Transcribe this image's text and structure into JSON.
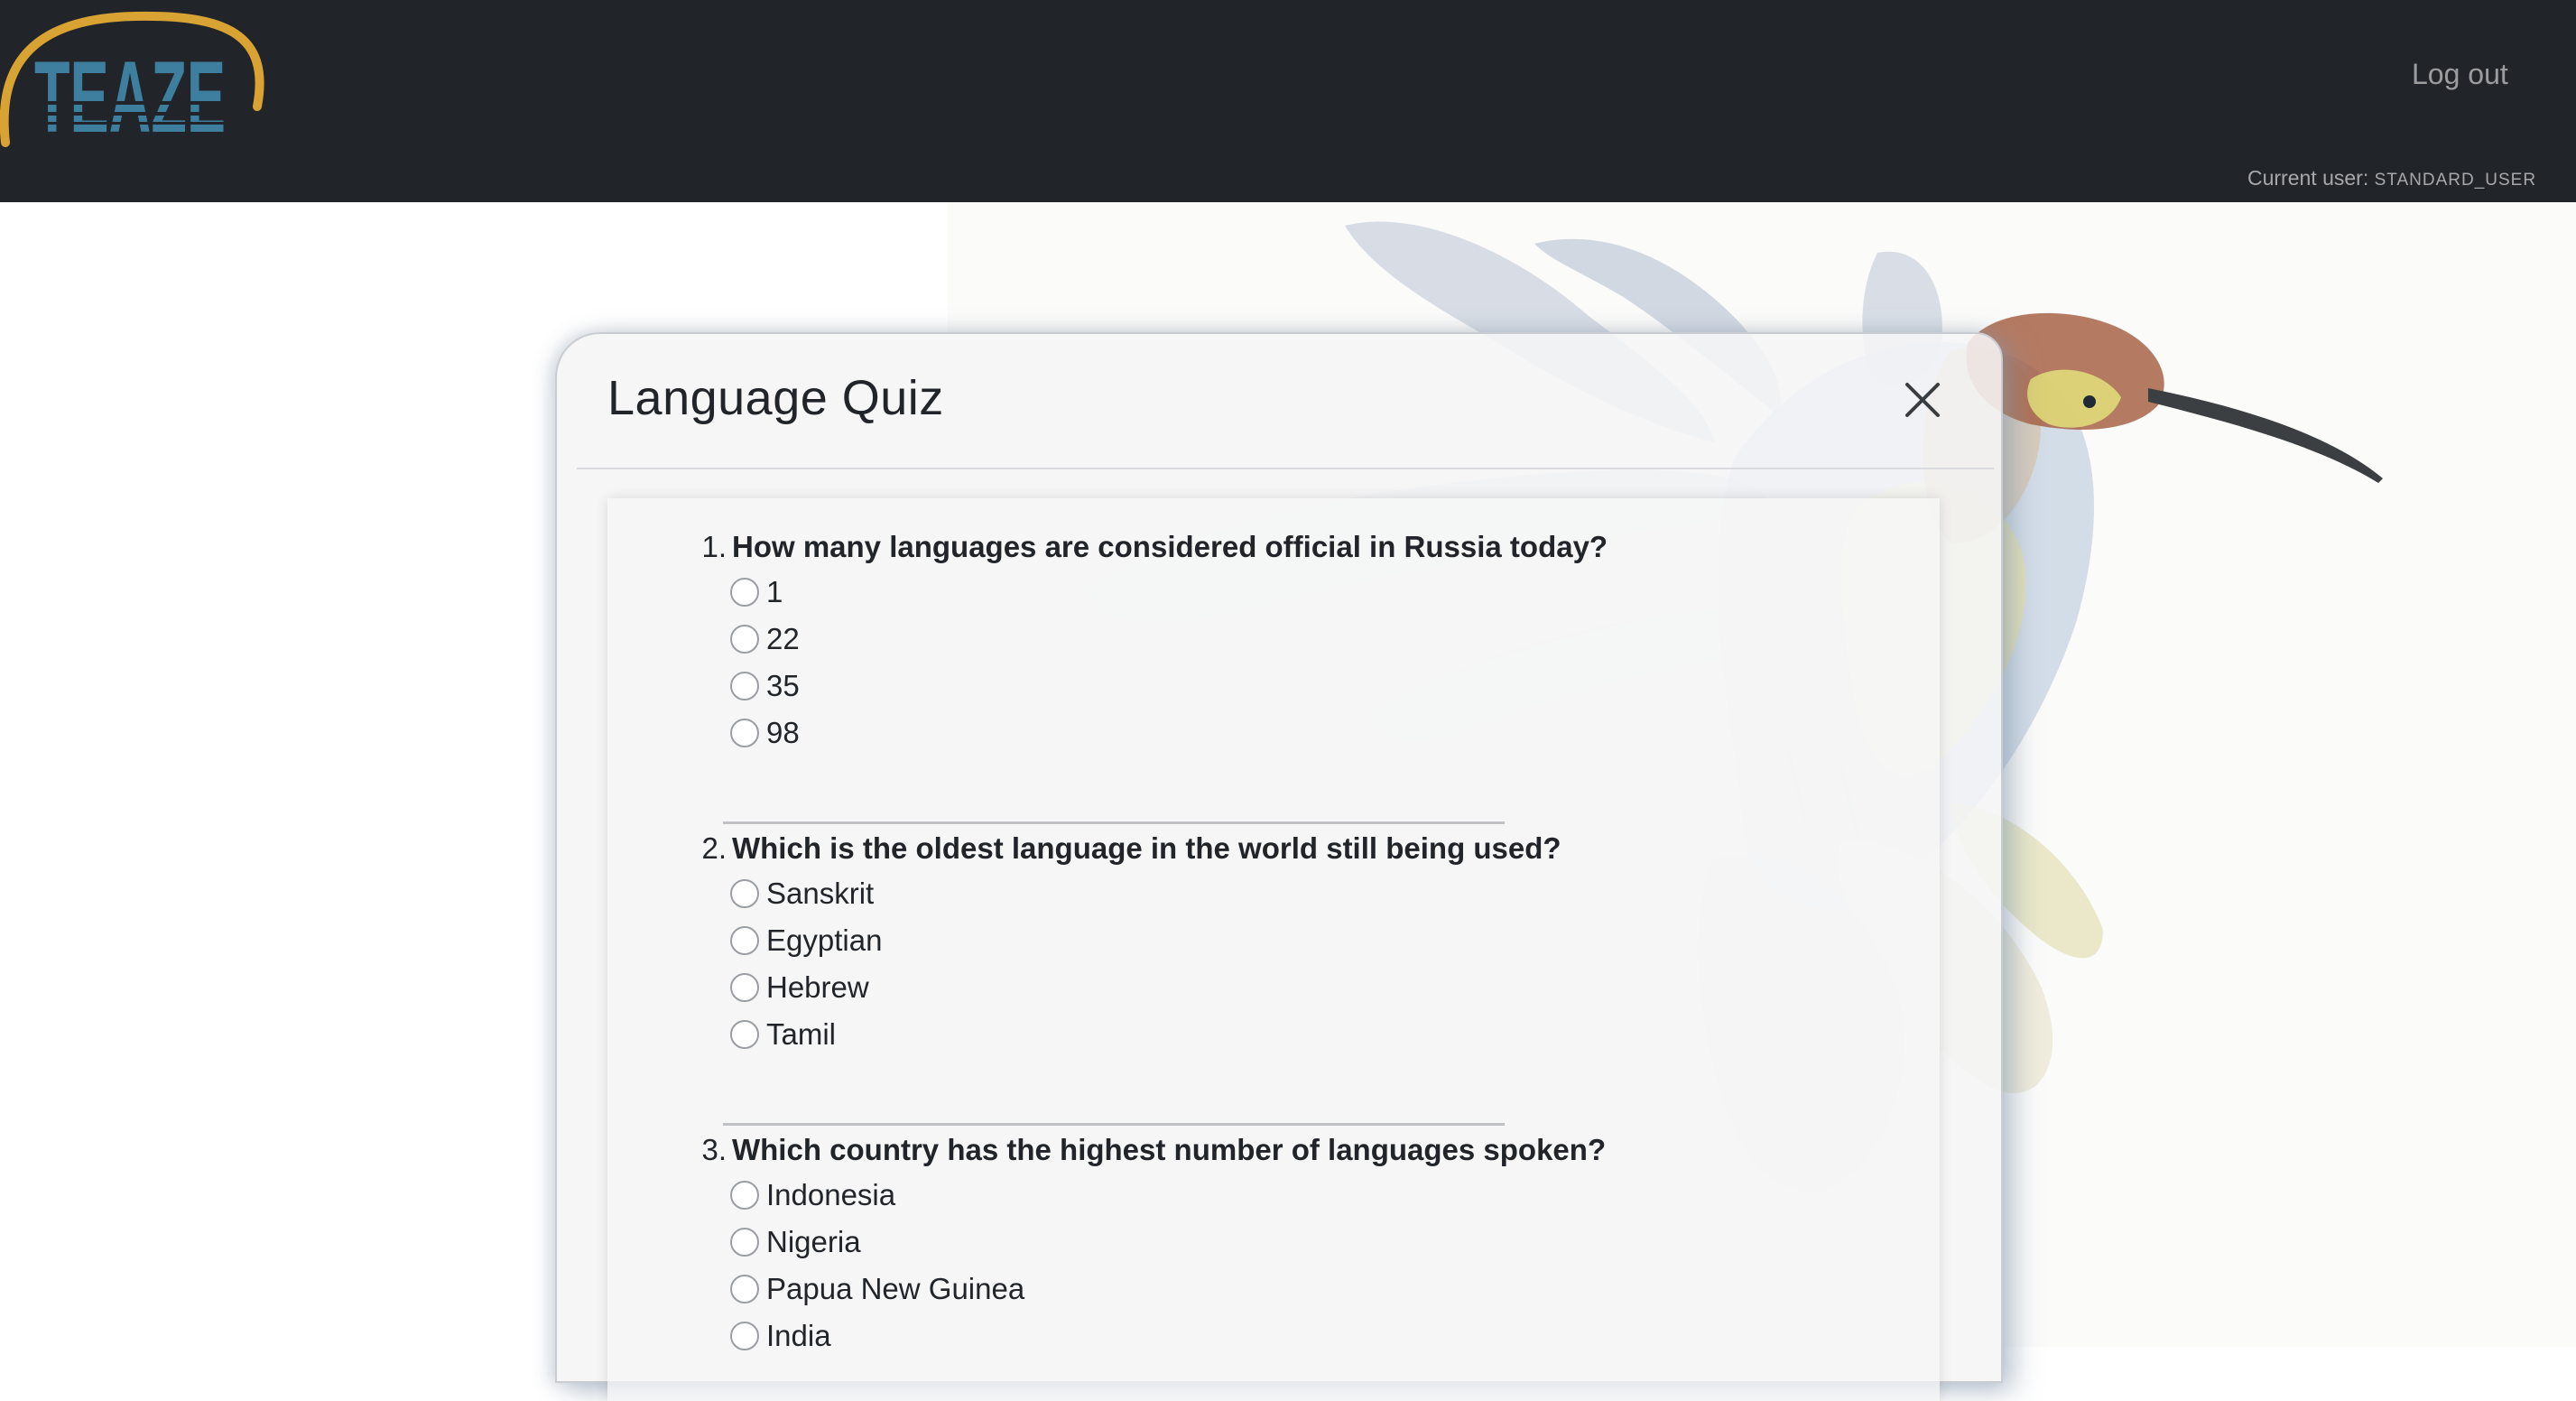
{
  "navbar": {
    "logo_text": "TEAZE",
    "logout_label": "Log out",
    "current_user_label": "Current user:",
    "current_user_name": "STANDARD_USER"
  },
  "modal": {
    "title": "Language Quiz",
    "close_icon": "close-x-icon"
  },
  "questions": [
    {
      "number": "1.",
      "text": "How many languages are considered official in Russia today?",
      "options": [
        "1",
        "22",
        "35",
        "98"
      ]
    },
    {
      "number": "2.",
      "text": "Which is the oldest language in the world still being used?",
      "options": [
        "Sanskrit",
        "Egyptian",
        "Hebrew",
        "Tamil"
      ]
    },
    {
      "number": "3.",
      "text": "Which country has the highest number of languages spoken?",
      "options": [
        "Indonesia",
        "Nigeria",
        "Papua New Guinea",
        "India"
      ]
    }
  ],
  "colors": {
    "navbar_bg": "#212529",
    "logo_arc": "#d9a334",
    "logo_letters": "#3e7fa0"
  }
}
